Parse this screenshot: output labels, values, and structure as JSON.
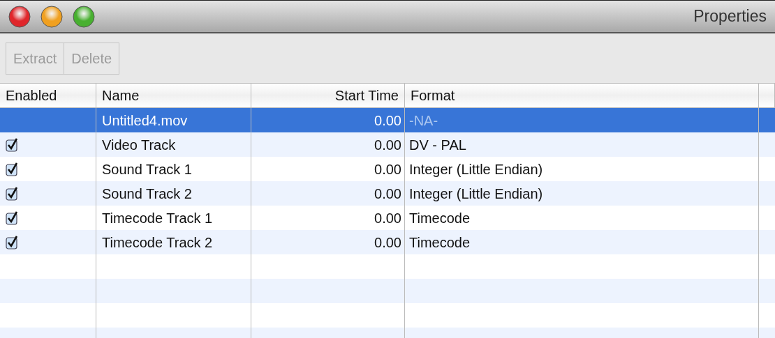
{
  "window": {
    "title": "Properties"
  },
  "toolbar": {
    "buttons": [
      {
        "label": "Extract",
        "disabled": true
      },
      {
        "label": "Delete",
        "disabled": true
      }
    ]
  },
  "table": {
    "columns": [
      "Enabled",
      "Name",
      "Start Time",
      "Format"
    ],
    "rows": [
      {
        "kind": "movie",
        "selected": true,
        "name": "Untitled4.mov",
        "start_time": "0.00",
        "format": "-NA-"
      },
      {
        "kind": "track",
        "selected": false,
        "checked": true,
        "name": "Video Track",
        "start_time": "0.00",
        "format": "DV - PAL"
      },
      {
        "kind": "track",
        "selected": false,
        "checked": true,
        "name": "Sound Track 1",
        "start_time": "0.00",
        "format": "Integer (Little Endian)"
      },
      {
        "kind": "track",
        "selected": false,
        "checked": true,
        "name": "Sound Track 2",
        "start_time": "0.00",
        "format": "Integer (Little Endian)"
      },
      {
        "kind": "track",
        "selected": false,
        "checked": true,
        "name": "Timecode Track 1",
        "start_time": "0.00",
        "format": "Timecode"
      },
      {
        "kind": "track",
        "selected": false,
        "checked": true,
        "name": "Timecode Track 2",
        "start_time": "0.00",
        "format": "Timecode"
      }
    ]
  }
}
